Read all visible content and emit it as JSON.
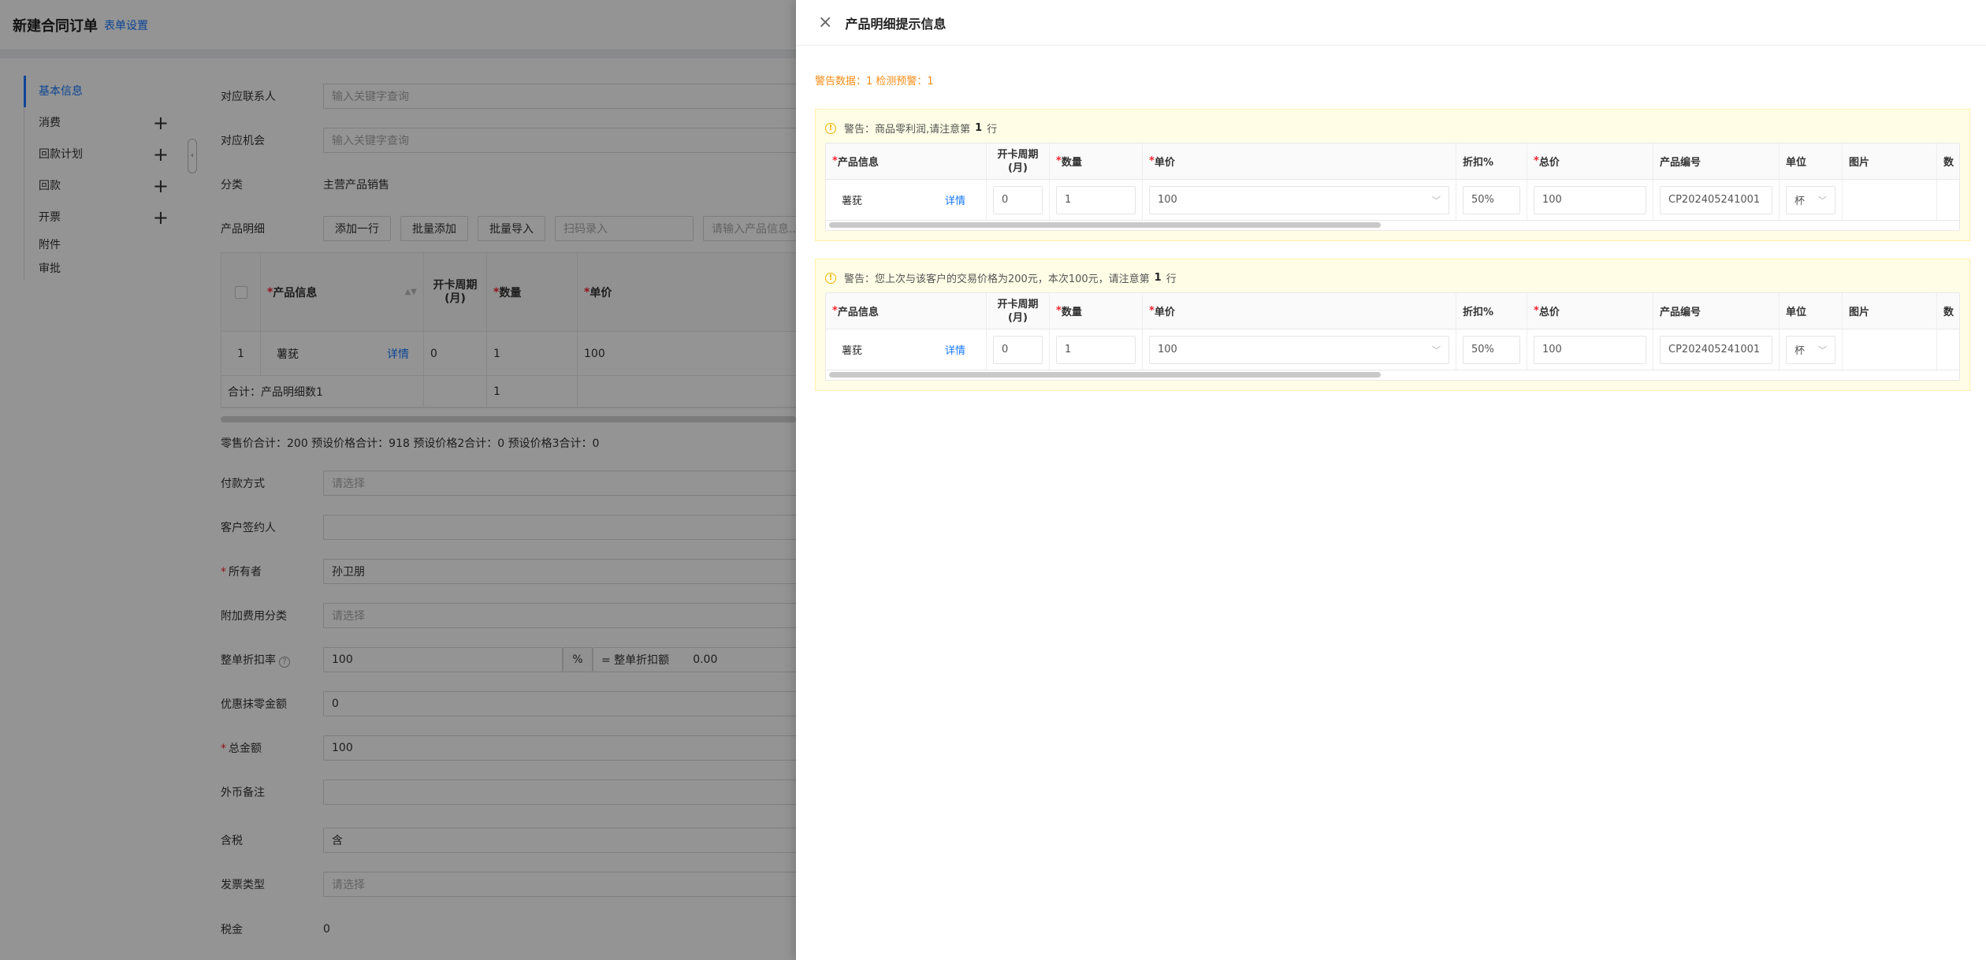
{
  "page": {
    "title": "新建合同订单",
    "settings_link": "表单设置",
    "nav": [
      {
        "label": "基本信息",
        "plus": ""
      },
      {
        "label": "消费",
        "plus": "+"
      },
      {
        "label": "回款计划",
        "plus": "+"
      },
      {
        "label": "回款",
        "plus": "+"
      },
      {
        "label": "开票",
        "plus": "+"
      },
      {
        "label": "附件",
        "plus": ""
      },
      {
        "label": "审批",
        "plus": ""
      }
    ],
    "collapse_icon": "‹",
    "fields": {
      "contact": {
        "label": "对应联系人",
        "placeholder": "输入关键字查询"
      },
      "opportunity": {
        "label": "对应机会",
        "placeholder": "输入关键字查询"
      },
      "category": {
        "label": "分类",
        "value": "主营产品销售"
      },
      "product_detail": {
        "label": "产品明细"
      },
      "payment_method": {
        "label": "付款方式",
        "placeholder": "请选择"
      },
      "signer": {
        "label": "客户签约人",
        "value": ""
      },
      "owner": {
        "label": "所有者",
        "value": "孙卫朋"
      },
      "extra_fee": {
        "label": "附加费用分类",
        "placeholder": "请选择"
      },
      "discount_rate": {
        "label": "整单折扣率",
        "value": "100",
        "unit": "%",
        "eq_label": "= 整单折扣额",
        "eq_value": "0.00"
      },
      "rounding": {
        "label": "优惠抹零金额",
        "value": "0"
      },
      "total": {
        "label": "总金额",
        "value": "100"
      },
      "fx_note": {
        "label": "外币备注",
        "value": ""
      },
      "tax_incl": {
        "label": "含税",
        "value": "含"
      },
      "invoice_type": {
        "label": "发票类型",
        "placeholder": "请选择"
      },
      "tax": {
        "label": "税金",
        "value": "0"
      }
    },
    "toolbar": {
      "add_row": "添加一行",
      "batch_add": "批量添加",
      "batch_import": "批量导入",
      "scan_placeholder": "扫码录入",
      "search_placeholder": "请输入产品信息..."
    },
    "table": {
      "headers": {
        "product": "产品信息",
        "cycle": "开卡周期(月)",
        "qty": "数量",
        "price": "单价"
      },
      "row": {
        "index": "1",
        "product": "薯莸",
        "detail": "详情",
        "cycle": "0",
        "qty": "1",
        "price": "100"
      },
      "sum_label": "合计：产品明细数1",
      "sum_qty": "1"
    },
    "totals_line": "零售价合计：200  预设价格合计：918  预设价格2合计：0  预设价格3合计：0"
  },
  "drawer": {
    "title": "产品明细提示信息",
    "close_icon": "×",
    "summary": "警告数据：1   检测预警：1",
    "warnings": [
      {
        "icon": "!",
        "prefix": "警告：商品零利润,请注意第",
        "row": "1",
        "suffix": "行"
      },
      {
        "icon": "!",
        "prefix": "警告：您上次与该客户的交易价格为200元，本次100元，请注意第",
        "row": "1",
        "suffix": "行"
      }
    ],
    "headers": {
      "product": "产品信息",
      "cycle": "开卡周期(月)",
      "qty": "数量",
      "price": "单价",
      "discount": "折扣%",
      "total": "总价",
      "code": "产品编号",
      "unit": "单位",
      "image": "图片",
      "more": "数"
    },
    "row": {
      "product": "薯莸",
      "detail": "详情",
      "cycle": "0",
      "qty": "1",
      "price": "100",
      "discount": "50%",
      "total": "100",
      "code": "CP202405241001",
      "unit": "杯"
    },
    "dropdown_icon": "﹀"
  },
  "colors": {
    "accent": "#1677ff",
    "warning": "#fa8c16",
    "required": "#f5222d",
    "warn_bg": "#fffde6"
  }
}
